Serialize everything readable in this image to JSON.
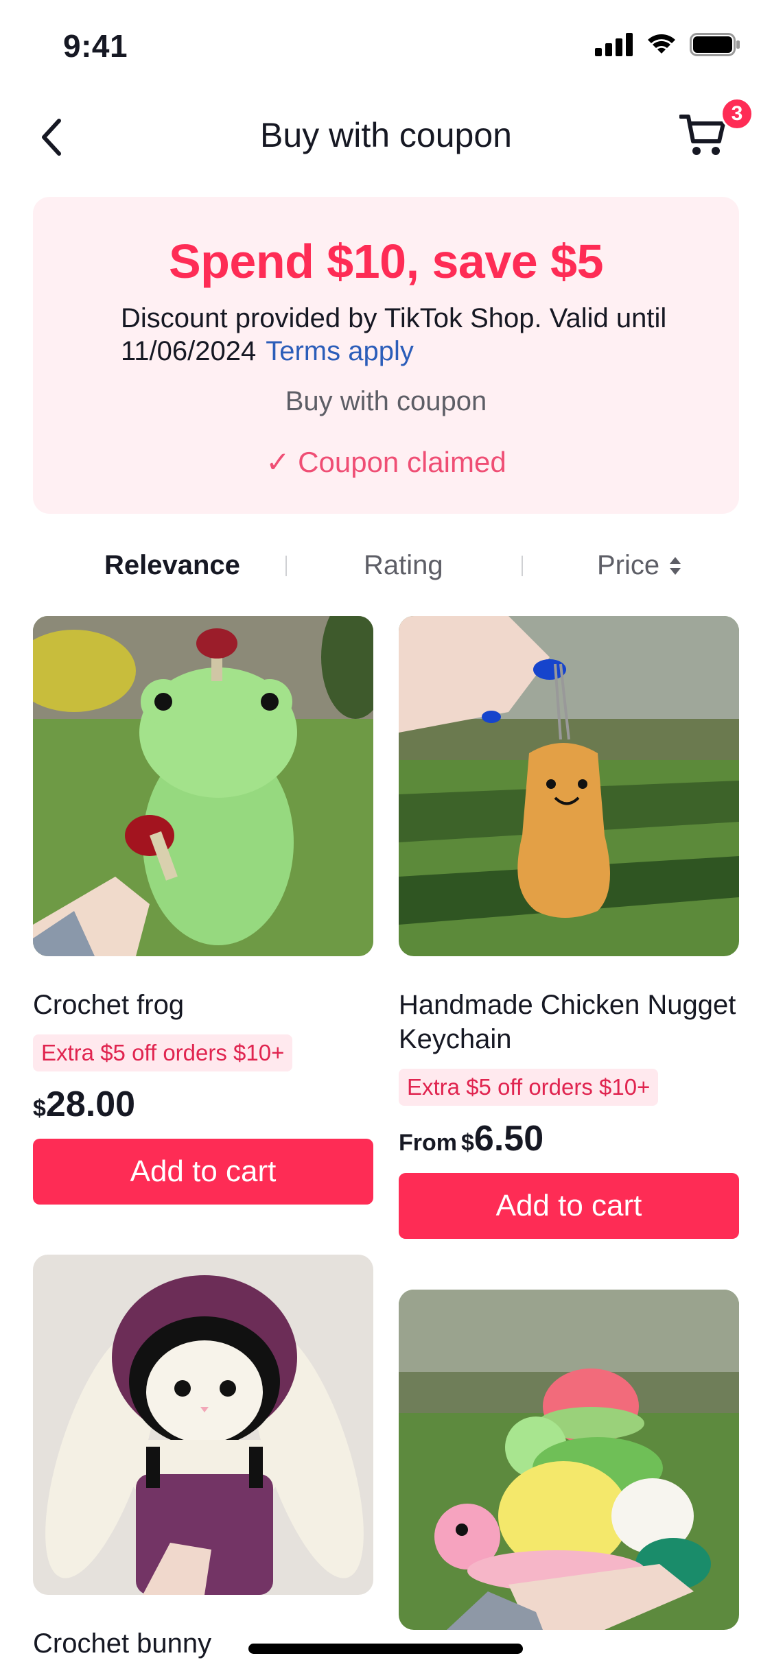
{
  "status_bar": {
    "time": "9:41"
  },
  "nav": {
    "title": "Buy with coupon",
    "cart_count": "3"
  },
  "coupon": {
    "headline": "Spend $10, save $5",
    "description": "Discount provided by TikTok Shop. Valid until 11/06/2024",
    "terms_link": "Terms apply",
    "subtitle": "Buy with coupon",
    "claimed_check": "✓",
    "claimed_text": "Coupon claimed"
  },
  "sort": {
    "relevance": "Relevance",
    "rating": "Rating",
    "price": "Price"
  },
  "products": [
    {
      "title": "Crochet frog",
      "promo": "Extra $5 off orders $10+",
      "price_prefix": "",
      "currency": "$",
      "price": "28.00",
      "button": "Add to cart"
    },
    {
      "title": "Handmade Chicken Nugget Keychain",
      "promo": "Extra $5 off orders $10+",
      "price_prefix": "From",
      "currency": "$",
      "price": "6.50",
      "button": "Add to cart"
    },
    {
      "title": "Crochet bunny"
    },
    {
      "title": ""
    }
  ],
  "colors": {
    "accent": "#fe2c55",
    "coupon_bg": "#fff0f3",
    "link": "#2b5db9",
    "promo_bg": "#ffe9ee"
  }
}
